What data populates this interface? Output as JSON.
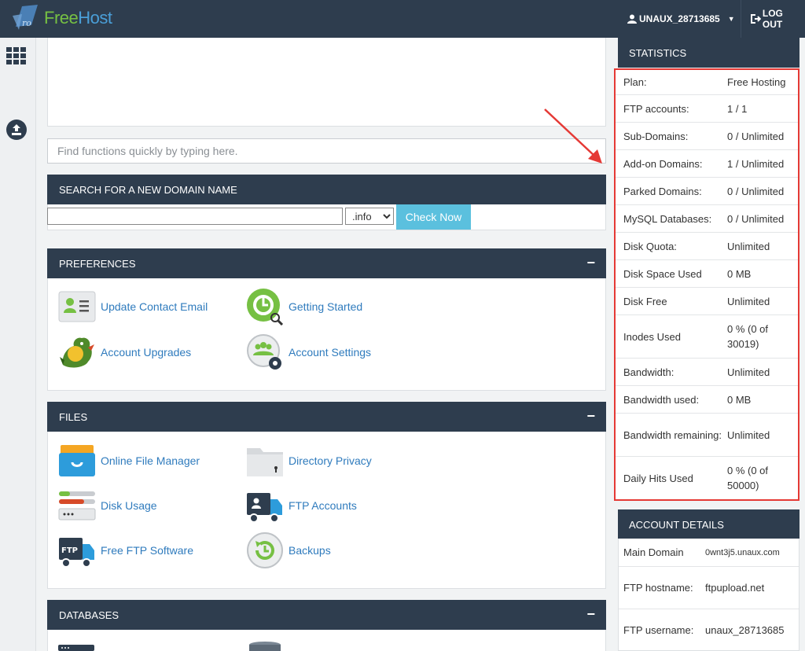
{
  "header": {
    "brand_free": "Free",
    "brand_host": "Host",
    "username": "UNAUX_28713685",
    "logout": "LOG OUT"
  },
  "quick_search": {
    "placeholder": "Find functions quickly by typing here."
  },
  "domain_search": {
    "title": "SEARCH FOR A NEW DOMAIN NAME",
    "tld_selected": ".info",
    "check_button": "Check Now"
  },
  "preferences": {
    "title": "PREFERENCES",
    "items": [
      {
        "label": "Update Contact Email",
        "icon": "contact-card-icon"
      },
      {
        "label": "Getting Started",
        "icon": "getting-started-icon"
      },
      {
        "label": "Account Upgrades",
        "icon": "dragon-icon"
      },
      {
        "label": "Account Settings",
        "icon": "account-settings-icon"
      }
    ]
  },
  "files": {
    "title": "FILES",
    "items": [
      {
        "label": "Online File Manager",
        "icon": "file-manager-icon"
      },
      {
        "label": "Directory Privacy",
        "icon": "folder-lock-icon"
      },
      {
        "label": "Disk Usage",
        "icon": "disk-usage-icon"
      },
      {
        "label": "FTP Accounts",
        "icon": "ftp-accounts-icon"
      },
      {
        "label": "Free FTP Software",
        "icon": "ftp-truck-icon"
      },
      {
        "label": "Backups",
        "icon": "backup-icon"
      }
    ]
  },
  "databases": {
    "title": "DATABASES"
  },
  "statistics": {
    "title": "STATISTICS",
    "rows": [
      {
        "key": "Plan:",
        "value": "Free Hosting"
      },
      {
        "key": "FTP accounts:",
        "value": "1 / 1"
      },
      {
        "key": "Sub-Domains:",
        "value": "0 / Unlimited"
      },
      {
        "key": "Add-on Domains:",
        "value": "1 / Unlimited"
      },
      {
        "key": "Parked Domains:",
        "value": "0 / Unlimited"
      },
      {
        "key": "MySQL Databases:",
        "value": "0 / Unlimited"
      },
      {
        "key": "Disk Quota:",
        "value": "Unlimited"
      },
      {
        "key": "Disk Space Used",
        "value": "0 MB"
      },
      {
        "key": "Disk Free",
        "value": "Unlimited"
      },
      {
        "key": "Inodes Used",
        "value": "0 % (0 of 30019)"
      },
      {
        "key": "Bandwidth:",
        "value": "Unlimited"
      },
      {
        "key": "Bandwidth used:",
        "value": "0 MB"
      },
      {
        "key": "Bandwidth remaining:",
        "value": "Unlimited"
      },
      {
        "key": "Daily Hits Used",
        "value": "0 % (0 of 50000)"
      }
    ]
  },
  "account_details": {
    "title": "ACCOUNT DETAILS",
    "rows": [
      {
        "key": "Main Domain",
        "value": "0wnt3j5.unaux.com"
      },
      {
        "key": "FTP hostname:",
        "value": "ftpupload.net"
      },
      {
        "key": "FTP username:",
        "value": "unaux_28713685"
      }
    ]
  },
  "colors": {
    "header_bg": "#2e3d4e",
    "link": "#2f7bbd",
    "highlight": "#e53935",
    "check_button": "#5bc0de"
  }
}
